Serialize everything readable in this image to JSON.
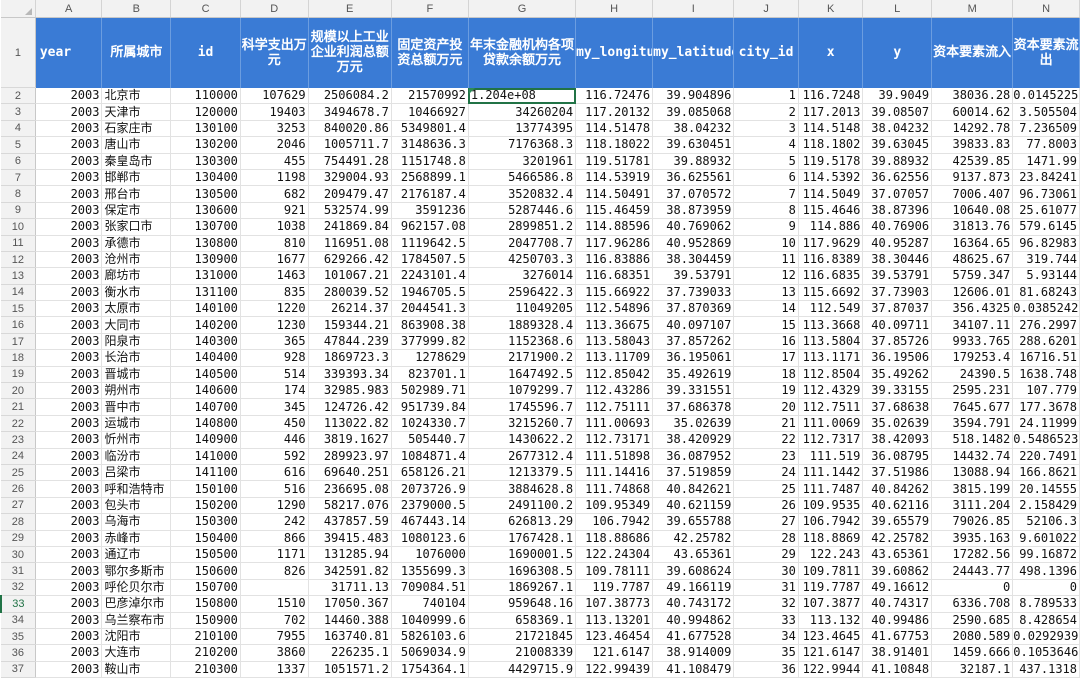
{
  "column_letters": [
    "",
    "A",
    "B",
    "C",
    "D",
    "E",
    "F",
    "G",
    "H",
    "I",
    "J",
    "K",
    "L",
    "M",
    "N"
  ],
  "header_row_number": "1",
  "headers": [
    "year",
    "所属城市",
    "id",
    "科学支出万元",
    "规模以上工业企业利润总额万元",
    "固定资产投资总额万元",
    "年末金融机构各项贷款余额万元",
    "my_longitude",
    "my_latitude",
    "city_id",
    "x",
    "y",
    "资本要素流入",
    "资本要素流出"
  ],
  "header_fill_color": "#3a7bd5",
  "selected_row": 33,
  "active_cell": "G2",
  "rows": [
    [
      "2",
      "2003",
      "北京市",
      "110000",
      "107629",
      "2506084.2",
      "21570992",
      "1.204e+08",
      "116.72476",
      "39.904896",
      "1",
      "116.7248",
      "39.9049",
      "38036.28",
      "0.0145225"
    ],
    [
      "3",
      "2003",
      "天津市",
      "120000",
      "19403",
      "3494678.7",
      "10466927",
      "34260204",
      "117.20132",
      "39.085068",
      "2",
      "117.2013",
      "39.08507",
      "60014.62",
      "3.505504"
    ],
    [
      "4",
      "2003",
      "石家庄市",
      "130100",
      "3253",
      "840020.86",
      "5349801.4",
      "13774395",
      "114.51478",
      "38.04232",
      "3",
      "114.5148",
      "38.04232",
      "14292.78",
      "7.236509"
    ],
    [
      "5",
      "2003",
      "唐山市",
      "130200",
      "2046",
      "1005711.7",
      "3148636.3",
      "7176368.3",
      "118.18022",
      "39.630451",
      "4",
      "118.1802",
      "39.63045",
      "39833.83",
      "77.8003"
    ],
    [
      "6",
      "2003",
      "秦皇岛市",
      "130300",
      "455",
      "754491.28",
      "1151748.8",
      "3201961",
      "119.51781",
      "39.88932",
      "5",
      "119.5178",
      "39.88932",
      "42539.85",
      "1471.99"
    ],
    [
      "7",
      "2003",
      "邯郸市",
      "130400",
      "1198",
      "329004.93",
      "2568899.1",
      "5466586.8",
      "114.53919",
      "36.625561",
      "6",
      "114.5392",
      "36.62556",
      "9137.873",
      "23.84241"
    ],
    [
      "8",
      "2003",
      "邢台市",
      "130500",
      "682",
      "209479.47",
      "2176187.4",
      "3520832.4",
      "114.50491",
      "37.070572",
      "7",
      "114.5049",
      "37.07057",
      "7006.407",
      "96.73061"
    ],
    [
      "9",
      "2003",
      "保定市",
      "130600",
      "921",
      "532574.99",
      "3591236",
      "5287446.6",
      "115.46459",
      "38.873959",
      "8",
      "115.4646",
      "38.87396",
      "10640.08",
      "25.61077"
    ],
    [
      "10",
      "2003",
      "张家口市",
      "130700",
      "1038",
      "241869.84",
      "962157.08",
      "2899851.2",
      "114.88596",
      "40.769062",
      "9",
      "114.886",
      "40.76906",
      "31813.76",
      "579.6145"
    ],
    [
      "11",
      "2003",
      "承德市",
      "130800",
      "810",
      "116951.08",
      "1119642.5",
      "2047708.7",
      "117.96286",
      "40.952869",
      "10",
      "117.9629",
      "40.95287",
      "16364.65",
      "96.82983"
    ],
    [
      "12",
      "2003",
      "沧州市",
      "130900",
      "1677",
      "629266.42",
      "1784507.5",
      "4250703.3",
      "116.83886",
      "38.304459",
      "11",
      "116.8389",
      "38.30446",
      "48625.67",
      "319.744"
    ],
    [
      "13",
      "2003",
      "廊坊市",
      "131000",
      "1463",
      "101067.21",
      "2243101.4",
      "3276014",
      "116.68351",
      "39.53791",
      "12",
      "116.6835",
      "39.53791",
      "5759.347",
      "5.93144"
    ],
    [
      "14",
      "2003",
      "衡水市",
      "131100",
      "835",
      "280039.52",
      "1946705.5",
      "2596422.3",
      "115.66922",
      "37.739033",
      "13",
      "115.6692",
      "37.73903",
      "12606.01",
      "81.68243"
    ],
    [
      "15",
      "2003",
      "太原市",
      "140100",
      "1220",
      "26214.37",
      "2044541.3",
      "11049205",
      "112.54896",
      "37.870369",
      "14",
      "112.549",
      "37.87037",
      "356.4325",
      "0.0385242"
    ],
    [
      "16",
      "2003",
      "大同市",
      "140200",
      "1230",
      "159344.21",
      "863908.38",
      "1889328.4",
      "113.36675",
      "40.097107",
      "15",
      "113.3668",
      "40.09711",
      "34107.11",
      "276.2997"
    ],
    [
      "17",
      "2003",
      "阳泉市",
      "140300",
      "365",
      "47844.239",
      "377999.82",
      "1152368.6",
      "113.58043",
      "37.857262",
      "16",
      "113.5804",
      "37.85726",
      "9933.765",
      "288.6201"
    ],
    [
      "18",
      "2003",
      "长治市",
      "140400",
      "928",
      "1869723.3",
      "1278629",
      "2171900.2",
      "113.11709",
      "36.195061",
      "17",
      "113.1171",
      "36.19506",
      "179253.4",
      "16716.51"
    ],
    [
      "19",
      "2003",
      "晋城市",
      "140500",
      "514",
      "339393.34",
      "823701.1",
      "1647492.5",
      "112.85042",
      "35.492619",
      "18",
      "112.8504",
      "35.49262",
      "24390.5",
      "1638.748"
    ],
    [
      "20",
      "2003",
      "朔州市",
      "140600",
      "174",
      "32985.983",
      "502989.71",
      "1079299.7",
      "112.43286",
      "39.331551",
      "19",
      "112.4329",
      "39.33155",
      "2595.231",
      "107.779"
    ],
    [
      "21",
      "2003",
      "晋中市",
      "140700",
      "345",
      "124726.42",
      "951739.84",
      "1745596.7",
      "112.75111",
      "37.686378",
      "20",
      "112.7511",
      "37.68638",
      "7645.677",
      "177.3678"
    ],
    [
      "22",
      "2003",
      "运城市",
      "140800",
      "450",
      "113022.82",
      "1024330.7",
      "3215260.7",
      "111.00693",
      "35.02639",
      "21",
      "111.0069",
      "35.02639",
      "3594.791",
      "24.11999"
    ],
    [
      "23",
      "2003",
      "忻州市",
      "140900",
      "446",
      "3819.1627",
      "505440.7",
      "1430622.2",
      "112.73171",
      "38.420929",
      "22",
      "112.7317",
      "38.42093",
      "518.1482",
      "0.5486523"
    ],
    [
      "24",
      "2003",
      "临汾市",
      "141000",
      "592",
      "289923.97",
      "1084871.4",
      "2677312.4",
      "111.51898",
      "36.087952",
      "23",
      "111.519",
      "36.08795",
      "14432.74",
      "220.7491"
    ],
    [
      "25",
      "2003",
      "吕梁市",
      "141100",
      "616",
      "69640.251",
      "658126.21",
      "1213379.5",
      "111.14416",
      "37.519859",
      "24",
      "111.1442",
      "37.51986",
      "13088.94",
      "166.8621"
    ],
    [
      "26",
      "2003",
      "呼和浩特市",
      "150100",
      "516",
      "236695.08",
      "2073726.9",
      "3884628.8",
      "111.74868",
      "40.842621",
      "25",
      "111.7487",
      "40.84262",
      "3815.199",
      "20.14555"
    ],
    [
      "27",
      "2003",
      "包头市",
      "150200",
      "1290",
      "58217.076",
      "2379000.5",
      "2491100.2",
      "109.95349",
      "40.621159",
      "26",
      "109.9535",
      "40.62116",
      "3111.204",
      "2.158429"
    ],
    [
      "28",
      "2003",
      "乌海市",
      "150300",
      "242",
      "437857.59",
      "467443.14",
      "626813.29",
      "106.7942",
      "39.655788",
      "27",
      "106.7942",
      "39.65579",
      "79026.85",
      "52106.3"
    ],
    [
      "29",
      "2003",
      "赤峰市",
      "150400",
      "866",
      "39415.483",
      "1080123.6",
      "1767428.1",
      "118.88686",
      "42.25782",
      "28",
      "118.8869",
      "42.25782",
      "3935.163",
      "9.601022"
    ],
    [
      "30",
      "2003",
      "通辽市",
      "150500",
      "1171",
      "131285.94",
      "1076000",
      "1690001.5",
      "122.24304",
      "43.65361",
      "29",
      "122.243",
      "43.65361",
      "17282.56",
      "99.16872"
    ],
    [
      "31",
      "2003",
      "鄂尔多斯市",
      "150600",
      "826",
      "342591.82",
      "1355699.3",
      "1696308.5",
      "109.78111",
      "39.608624",
      "30",
      "109.7811",
      "39.60862",
      "24443.77",
      "498.1396"
    ],
    [
      "32",
      "2003",
      "呼伦贝尔市",
      "150700",
      "",
      "31711.13",
      "709084.51",
      "1869267.1",
      "119.7787",
      "49.166119",
      "31",
      "119.7787",
      "49.16612",
      "0",
      "0"
    ],
    [
      "33",
      "2003",
      "巴彦淖尔市",
      "150800",
      "1510",
      "17050.367",
      "740104",
      "959648.16",
      "107.38773",
      "40.743172",
      "32",
      "107.3877",
      "40.74317",
      "6336.708",
      "8.789533"
    ],
    [
      "34",
      "2003",
      "乌兰察布市",
      "150900",
      "702",
      "14460.388",
      "1040999.6",
      "658369.1",
      "113.13201",
      "40.994862",
      "33",
      "113.132",
      "40.99486",
      "2590.685",
      "8.428654"
    ],
    [
      "35",
      "2003",
      "沈阳市",
      "210100",
      "7955",
      "163740.81",
      "5826103.6",
      "21721845",
      "123.46454",
      "41.677528",
      "34",
      "123.4645",
      "41.67753",
      "2080.589",
      "0.0292939"
    ],
    [
      "36",
      "2003",
      "大连市",
      "210200",
      "3860",
      "226235.1",
      "5069034.9",
      "21008339",
      "121.6147",
      "38.914009",
      "35",
      "121.6147",
      "38.91401",
      "1459.666",
      "0.1053646"
    ],
    [
      "37",
      "2003",
      "鞍山市",
      "210300",
      "1337",
      "1051571.2",
      "1754364.1",
      "4429715.9",
      "122.99439",
      "41.108479",
      "36",
      "122.9944",
      "41.10848",
      "32187.1",
      "437.1318"
    ]
  ]
}
